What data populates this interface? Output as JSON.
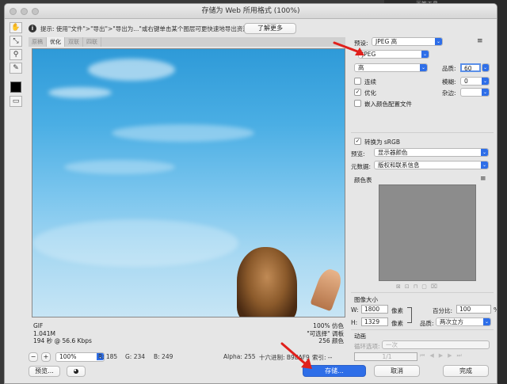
{
  "background": {
    "top_right_text": "画笔工具"
  },
  "window": {
    "title": "存储为 Web 所用格式 (100%)"
  },
  "infobar": {
    "text": "提示: 使用\"文件\">\"导出\">\"导出为...\"或右键单击某个图层可更快速地导出资源",
    "learn_more_label": "了解更多"
  },
  "tools": [
    "hand-tool",
    "slice-select-tool",
    "zoom-tool",
    "eyedropper-tool"
  ],
  "tabs": [
    "原稿",
    "优化",
    "双联",
    "四联"
  ],
  "active_tab": "优化",
  "image_info": {
    "left": [
      "GIF",
      "1.041M",
      "194 秒 @ 56.6 Kbps"
    ],
    "right": [
      "100% 仿色",
      "\"可选择\" 调板",
      "256 颜色"
    ]
  },
  "statusbar": {
    "zoom": "100%",
    "r": "R: 185",
    "g": "G: 234",
    "b": "B: 249",
    "alpha": "Alpha: 255",
    "hex": "十六进制: B9EAF9",
    "index": "索引: --"
  },
  "settings": {
    "preset_label": "预设:",
    "preset_value": "JPEG 高",
    "format_value": "JPEG",
    "quality_level": "高",
    "quality_label": "品质:",
    "quality_value": "60",
    "progressive_label": "连续",
    "blur_label": "模糊:",
    "blur_value": "0",
    "optimized_label": "优化",
    "optimized_checked": true,
    "matte_label": "杂边:",
    "embed_profile_label": "嵌入颜色配置文件",
    "convert_srgb_label": "转换为 sRGB",
    "convert_srgb_checked": true,
    "preview_label": "预览:",
    "preview_value": "显示器颜色",
    "metadata_label": "元数据:",
    "metadata_value": "版权和联系信息",
    "color_table_label": "颜色表",
    "image_size_label": "图像大小",
    "width_label": "W:",
    "width_value": "1800",
    "height_label": "H:",
    "height_value": "1329",
    "unit_label": "像素",
    "percent_label": "百分比:",
    "percent_value": "100",
    "percent_unit": "%",
    "resample_label": "品质:",
    "resample_value": "两次立方",
    "animation_label": "动画",
    "loop_label": "循环选项:",
    "loop_value": "一次",
    "frame_counter": "1/1"
  },
  "buttons": {
    "preview": "预览...",
    "save": "存储...",
    "cancel": "取消",
    "done": "完成"
  },
  "colors": {
    "save_button": "#2e6ee8",
    "accent_arrow": "#e0201c",
    "color_table": "#8c8c8c"
  }
}
